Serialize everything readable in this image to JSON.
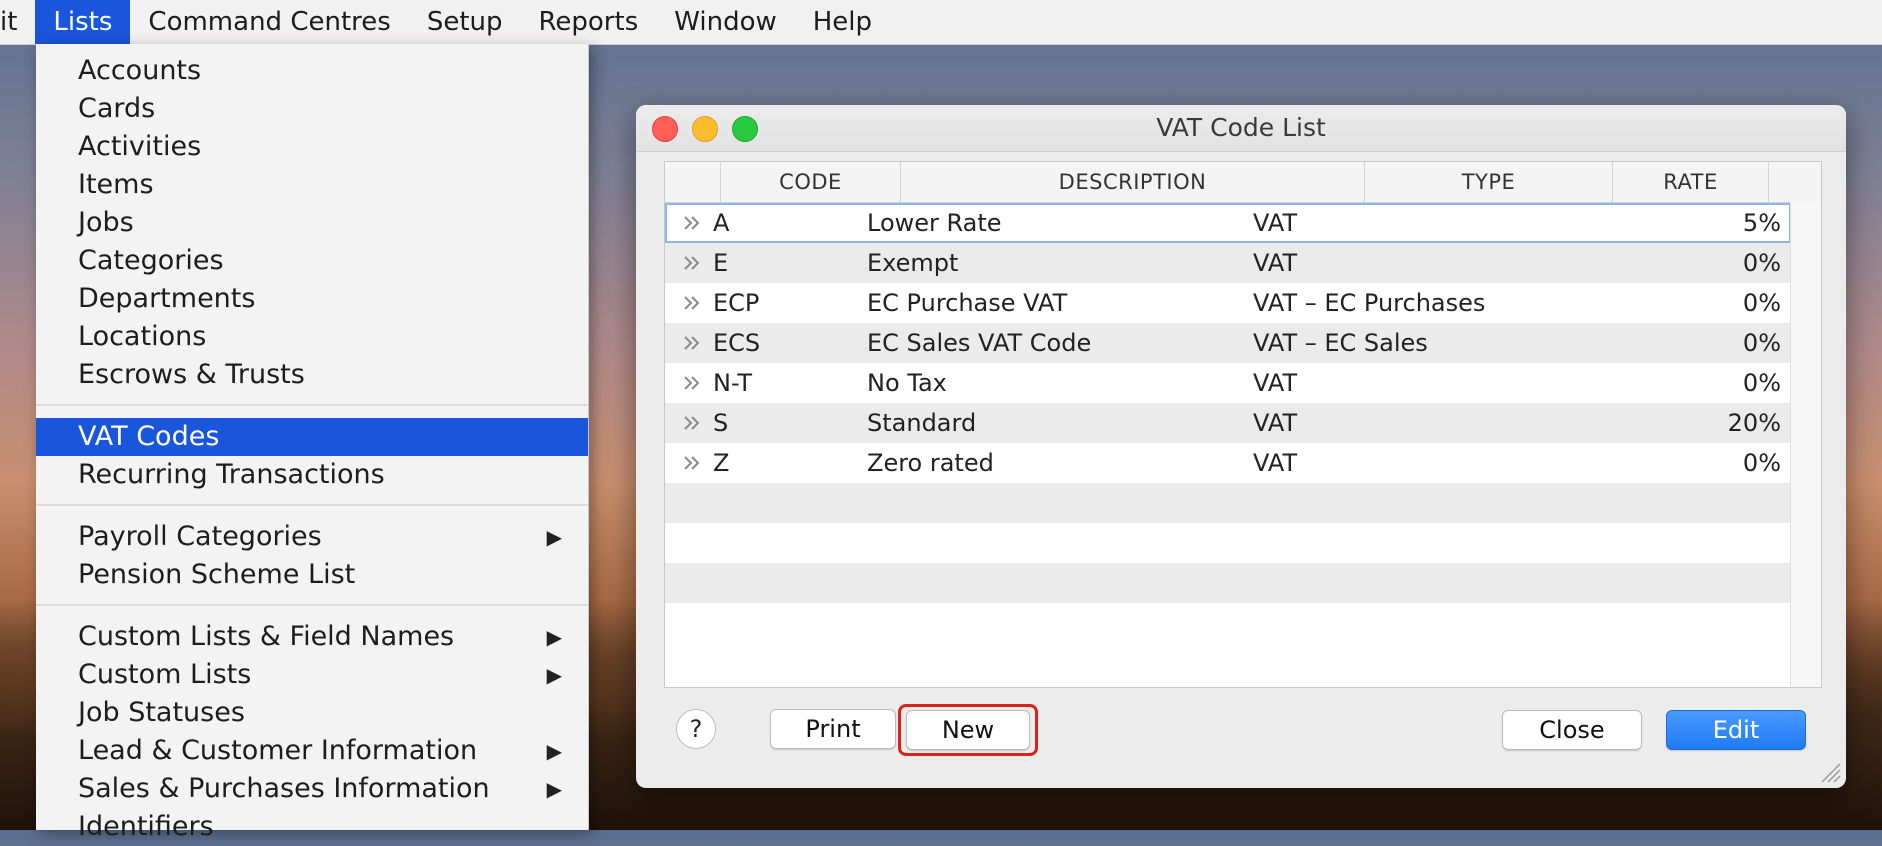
{
  "menubar": {
    "items": [
      "it",
      "Lists",
      "Command Centres",
      "Setup",
      "Reports",
      "Window",
      "Help"
    ]
  },
  "lists_menu": {
    "items": [
      {
        "label": "Accounts"
      },
      {
        "label": "Cards"
      },
      {
        "label": "Activities"
      },
      {
        "label": "Items"
      },
      {
        "label": "Jobs"
      },
      {
        "label": "Categories"
      },
      {
        "label": "Departments"
      },
      {
        "label": "Locations"
      },
      {
        "label": "Escrows & Trusts"
      },
      {
        "label": "VAT Codes"
      },
      {
        "label": "Recurring Transactions"
      },
      {
        "label": "Payroll Categories",
        "submenu": "▶"
      },
      {
        "label": "Pension Scheme List"
      },
      {
        "label": "Custom Lists & Field Names",
        "submenu": "▶"
      },
      {
        "label": "Custom Lists",
        "submenu": "▶"
      },
      {
        "label": "Job Statuses"
      },
      {
        "label": "Lead & Customer Information",
        "submenu": "▶"
      },
      {
        "label": "Sales & Purchases Information",
        "submenu": "▶"
      },
      {
        "label": "Identifiers"
      }
    ],
    "selected": "VAT Codes"
  },
  "window": {
    "title": "VAT Code List",
    "columns": [
      "CODE",
      "DESCRIPTION",
      "TYPE",
      "RATE"
    ],
    "rows": [
      {
        "code": "A",
        "description": "Lower Rate",
        "type": "VAT",
        "rate": "5%"
      },
      {
        "code": "E",
        "description": "Exempt",
        "type": "VAT",
        "rate": "0%"
      },
      {
        "code": "ECP",
        "description": "EC Purchase VAT",
        "type": "VAT – EC Purchases",
        "rate": "0%"
      },
      {
        "code": "ECS",
        "description": "EC Sales VAT Code",
        "type": "VAT – EC Sales",
        "rate": "0%"
      },
      {
        "code": "N-T",
        "description": "No Tax",
        "type": "VAT",
        "rate": "0%"
      },
      {
        "code": "S",
        "description": "Standard",
        "type": "VAT",
        "rate": "20%"
      },
      {
        "code": "Z",
        "description": "Zero rated",
        "type": "VAT",
        "rate": "0%"
      }
    ],
    "buttons": {
      "help": "?",
      "print": "Print",
      "new": "New",
      "close": "Close",
      "edit": "Edit"
    }
  },
  "colors": {
    "selection": "#1a56db",
    "primary_button": "#1f7af2",
    "highlight_box": "#d9231a"
  }
}
